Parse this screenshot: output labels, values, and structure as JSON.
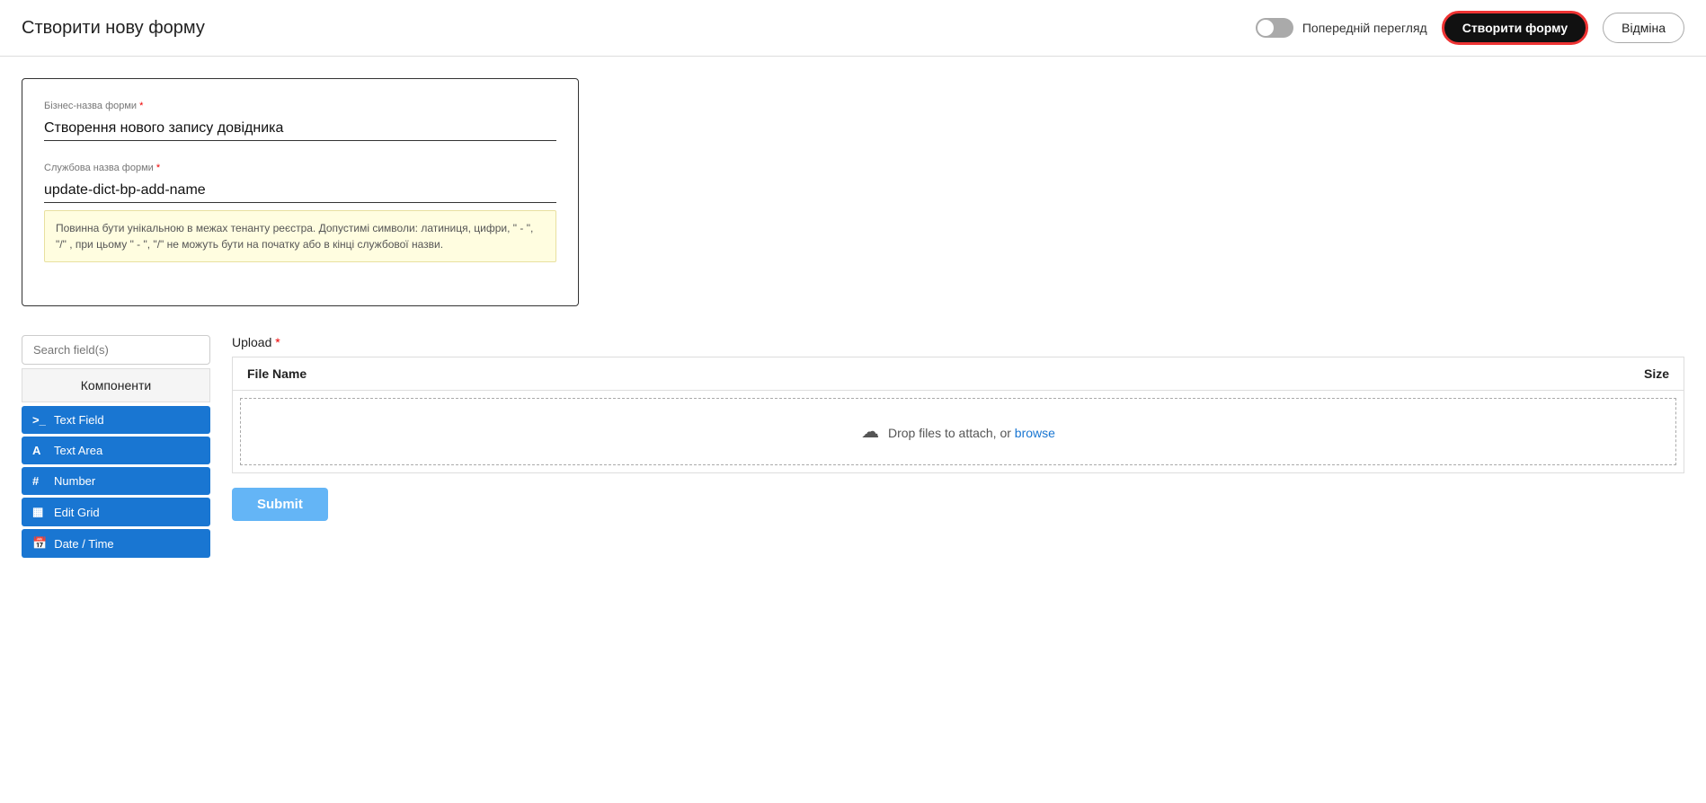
{
  "header": {
    "title": "Створити нову форму",
    "preview_label": "Попередній перегляд",
    "create_button": "Створити форму",
    "cancel_button": "Відміна"
  },
  "form_card": {
    "business_name_label": "Бізнес-назва форми",
    "business_name_required": "*",
    "business_name_value": "Створення нового запису довідника",
    "service_name_label": "Службова назва форми",
    "service_name_required": "*",
    "service_name_value": "update-dict-bp-add-name",
    "hint_text": "Повинна бути унікальною в межах тенанту реєстра. Допустимі символи: латиниця, цифри, \" - \", \"/\" , при цьому \" - \", \"/\" не можуть бути на початку або в кінці службової назви."
  },
  "left_panel": {
    "search_placeholder": "Search field(s)",
    "components_header": "Компоненти",
    "items": [
      {
        "icon": ">_",
        "label": "Text Field"
      },
      {
        "icon": "A",
        "label": "Text Area"
      },
      {
        "icon": "#",
        "label": "Number"
      },
      {
        "icon": "▦",
        "label": "Edit Grid"
      },
      {
        "icon": "📅",
        "label": "Date / Time"
      }
    ]
  },
  "right_panel": {
    "upload_label": "Upload",
    "upload_required": "*",
    "table_col_filename": "File Name",
    "table_col_size": "Size",
    "drop_text": "Drop files to attach, or",
    "browse_text": "browse",
    "submit_button": "Submit"
  }
}
